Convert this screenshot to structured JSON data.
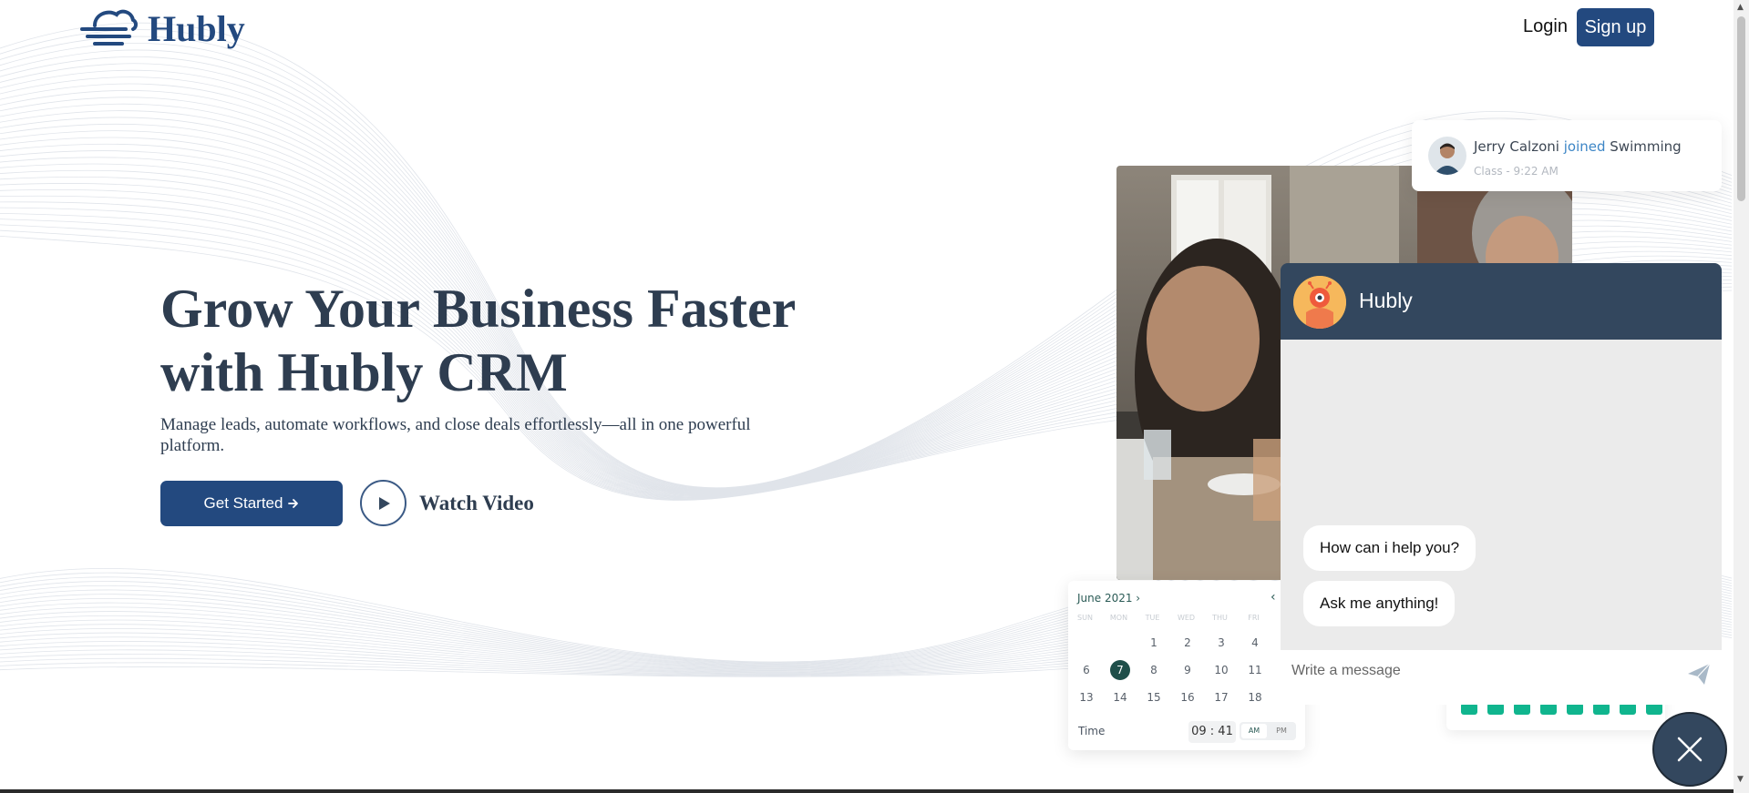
{
  "brand": {
    "name": "Hubly",
    "logo_icon": "cloud-wind-icon",
    "color": "#23497f"
  },
  "nav": {
    "login_label": "Login",
    "signup_label": "Sign up"
  },
  "hero": {
    "title": "Grow Your Business Faster with Hubly CRM",
    "subtitle": "Manage leads, automate workflows, and close deals effortlessly—all in one powerful platform.",
    "cta_label": "Get Started",
    "cta_icon": "arrow-right-icon",
    "video_label": "Watch Video",
    "video_icon": "play-icon"
  },
  "notification": {
    "name": "Jerry Calzoni",
    "action": "joined",
    "target": "Swimming",
    "line2": "Class -  9:22 AM",
    "accent": "#3d86c6"
  },
  "calendar": {
    "month_label": "June 2021 ›",
    "back_icon": "chevron-left-icon",
    "weekdays": [
      "SUN",
      "MON",
      "TUE",
      "WED",
      "THU",
      "FRI"
    ],
    "days": [
      "1",
      "2",
      "3",
      "4",
      "6",
      "7",
      "8",
      "9",
      "10",
      "11",
      "13",
      "14",
      "15",
      "16",
      "17",
      "18"
    ],
    "selected_day": "7",
    "time_label": "Time",
    "time_value": "09 : 41",
    "am_label": "AM",
    "pm_label": "PM",
    "accent": "#1f4f4a"
  },
  "progress_bars": {
    "count": 8,
    "color": "#10b58e"
  },
  "chat": {
    "title": "Hubly",
    "avatar_icon": "robot-icon",
    "messages": [
      "How can i help you?",
      "Ask me anything!"
    ],
    "input_placeholder": "Write a message",
    "send_icon": "send-icon",
    "header_color": "#33475e"
  },
  "close_icon": "close-icon"
}
